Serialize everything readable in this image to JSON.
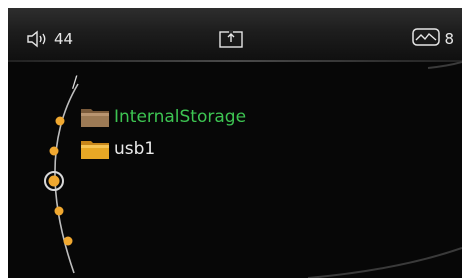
{
  "status_bar": {
    "volume_icon": "speaker-icon",
    "volume_value": "44",
    "center_icon": "media-source-icon",
    "right_icon": "signal-image-icon",
    "right_value": "8"
  },
  "browser": {
    "current_path": "/",
    "items": [
      {
        "label": "InternalStorage",
        "icon": "folder-icon",
        "highlighted": true
      },
      {
        "label": "usb1",
        "icon": "folder-icon",
        "highlighted": false
      }
    ]
  },
  "colors": {
    "highlight_text": "#3dc452",
    "normal_text": "#eaeaea",
    "folder": "#e8a825",
    "scroll_dot": "#f0a830",
    "background": "#070707"
  }
}
